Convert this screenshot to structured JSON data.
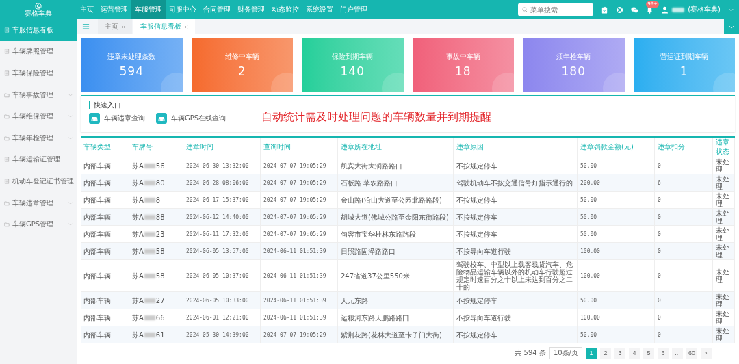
{
  "logo": {
    "text": "赛格车典"
  },
  "nav": [
    {
      "label": "主页",
      "selected": false
    },
    {
      "label": "运营管理",
      "selected": false
    },
    {
      "label": "车服管理",
      "selected": true
    },
    {
      "label": "司服中心",
      "selected": false
    },
    {
      "label": "合同管理",
      "selected": false
    },
    {
      "label": "财务管理",
      "selected": false
    },
    {
      "label": "动态监控",
      "selected": false
    },
    {
      "label": "系统设置",
      "selected": false
    },
    {
      "label": "门户管理",
      "selected": false
    }
  ],
  "search": {
    "placeholder": "菜单搜索"
  },
  "notifications": {
    "badge": "99+"
  },
  "user": {
    "name": "(赛格车典)"
  },
  "sidebar": {
    "items": [
      {
        "label": "车服信息看板",
        "selected": true,
        "expandable": false
      },
      {
        "label": "车辆牌照管理",
        "selected": false,
        "expandable": false
      },
      {
        "label": "车辆保险管理",
        "selected": false,
        "expandable": false
      },
      {
        "label": "车辆事故管理",
        "selected": false,
        "expandable": true
      },
      {
        "label": "车辆维保管理",
        "selected": false,
        "expandable": true
      },
      {
        "label": "车辆年检管理",
        "selected": false,
        "expandable": true
      },
      {
        "label": "车辆运输证管理",
        "selected": false,
        "expandable": false
      },
      {
        "label": "机动车登记证书管理",
        "selected": false,
        "expandable": false
      },
      {
        "label": "车辆违章管理",
        "selected": false,
        "expandable": true
      },
      {
        "label": "车辆GPS管理",
        "selected": false,
        "expandable": true
      }
    ]
  },
  "tabs": [
    {
      "label": "主页",
      "selected": false
    },
    {
      "label": "车服信息看板",
      "selected": true
    }
  ],
  "cards": [
    {
      "label": "违章未处理条数",
      "value": "594",
      "color": "#3a8ff0"
    },
    {
      "label": "维修中车辆",
      "value": "2",
      "color": "#f56a2c"
    },
    {
      "label": "保险到期车辆",
      "value": "140",
      "color": "#22cf9a"
    },
    {
      "label": "事故中车辆",
      "value": "18",
      "color": "#f0607a"
    },
    {
      "label": "须年检车辆",
      "value": "180",
      "color": "#8c86ee"
    },
    {
      "label": "营运证到期车辆",
      "value": "1",
      "color": "#2aaef0"
    }
  ],
  "quick_entry": {
    "title": "快速入口",
    "links": [
      "车辆违章查询",
      "车辆GPS在线查询"
    ]
  },
  "annotation": "自动统计需及时处理问题的车辆数量并到期提醒",
  "table": {
    "columns": [
      "车辆类型",
      "车牌号",
      "违章时间",
      "查询时间",
      "违章所在地址",
      "违章原因",
      "违章罚款金额(元)",
      "违章扣分",
      "违章状态"
    ],
    "rows": [
      {
        "type": "内部车辆",
        "plate_prefix": "苏A",
        "plate_suffix": "56",
        "time": "2024-06-30 13:32:00",
        "query_time": "2024-07-07 19:05:29",
        "address": "凯宾大街大涧路路口",
        "reason": "不按规定停车",
        "fine": "50.00",
        "points": "0",
        "status": "未处理"
      },
      {
        "type": "内部车辆",
        "plate_prefix": "苏A",
        "plate_suffix": "80",
        "time": "2024-06-28 08:06:00",
        "query_time": "2024-07-07 19:05:29",
        "address": "石板路 苹农路路口",
        "reason": "驾驶机动车不按交通信号灯指示通行的",
        "fine": "200.00",
        "points": "6",
        "status": "未处理"
      },
      {
        "type": "内部车辆",
        "plate_prefix": "苏A",
        "plate_suffix": "8",
        "time": "2024-06-17 15:37:00",
        "query_time": "2024-07-07 19:05:29",
        "address": "金山路(沿山大道至公园北路路段)",
        "reason": "不按规定停车",
        "fine": "50.00",
        "points": "0",
        "status": "未处理"
      },
      {
        "type": "内部车辆",
        "plate_prefix": "苏A",
        "plate_suffix": "88",
        "time": "2024-06-12 14:40:00",
        "query_time": "2024-07-07 19:05:29",
        "address": "胡城大道(佛城公路至金阳东街路段)",
        "reason": "不按规定停车",
        "fine": "50.00",
        "points": "0",
        "status": "未处理"
      },
      {
        "type": "内部车辆",
        "plate_prefix": "苏A",
        "plate_suffix": "23",
        "time": "2024-06-11 17:32:00",
        "query_time": "2024-07-07 19:05:29",
        "address": "句容市宝华杜林东路路段",
        "reason": "不按规定停车",
        "fine": "50.00",
        "points": "0",
        "status": "未处理"
      },
      {
        "type": "内部车辆",
        "plate_prefix": "苏A",
        "plate_suffix": "58",
        "time": "2024-06-05 13:57:00",
        "query_time": "2024-06-11 01:51:39",
        "address": "日照路固泽路路口",
        "reason": "不按导向车道行驶",
        "fine": "100.00",
        "points": "0",
        "status": "未处理"
      },
      {
        "type": "内部车辆",
        "plate_prefix": "苏A",
        "plate_suffix": "58",
        "time": "2024-06-05 10:37:00",
        "query_time": "2024-06-11 01:51:39",
        "address": "247省道37公里550米",
        "reason": "驾驶校车、中型以上载客载货汽车、危险物品运输车辆以外的机动车行驶超过规定时速百分之十以上未达到百分之二十的",
        "fine": "100.00",
        "points": "0",
        "status": "未处理"
      },
      {
        "type": "内部车辆",
        "plate_prefix": "苏A",
        "plate_suffix": "27",
        "time": "2024-06-05 10:33:00",
        "query_time": "2024-06-11 01:51:39",
        "address": "天元东路",
        "reason": "不按规定停车",
        "fine": "50.00",
        "points": "0",
        "status": "未处理"
      },
      {
        "type": "内部车辆",
        "plate_prefix": "苏A",
        "plate_suffix": "66",
        "time": "2024-06-01 12:21:00",
        "query_time": "2024-06-11 01:51:39",
        "address": "运粮河东路天鹏路路口",
        "reason": "不按导向车道行驶",
        "fine": "100.00",
        "points": "0",
        "status": "未处理"
      },
      {
        "type": "内部车辆",
        "plate_prefix": "苏A",
        "plate_suffix": "61",
        "time": "2024-05-30 14:39:00",
        "query_time": "2024-07-07 19:05:29",
        "address": "紫荆花路(花林大道至卡子门大街)",
        "reason": "不按规定停车",
        "fine": "50.00",
        "points": "0",
        "status": "未处理"
      }
    ]
  },
  "pagination": {
    "total": "共 594 条",
    "page_size": "10条/页",
    "pages": [
      {
        "label": "1",
        "selected": true
      },
      {
        "label": "2",
        "selected": false
      },
      {
        "label": "3",
        "selected": false
      },
      {
        "label": "4",
        "selected": false
      },
      {
        "label": "5",
        "selected": false
      },
      {
        "label": "6",
        "selected": false
      },
      {
        "label": "...",
        "selected": false
      },
      {
        "label": "60",
        "selected": false
      }
    ],
    "next": "›"
  }
}
